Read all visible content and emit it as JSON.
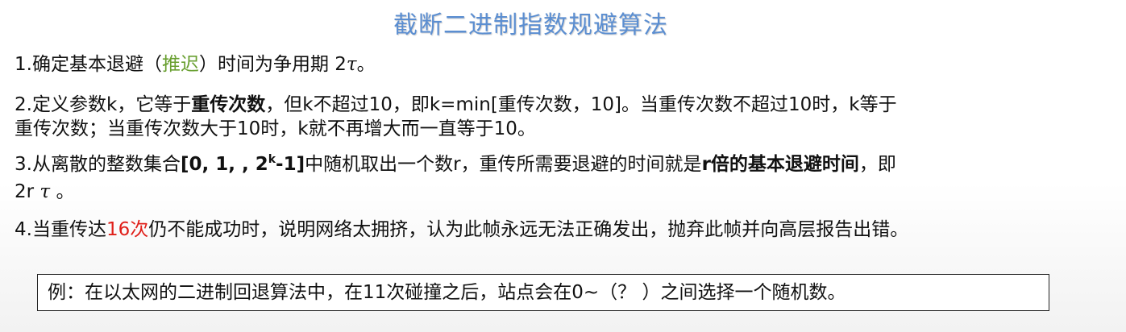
{
  "title": "截断二进制指数规避算法",
  "items": {
    "p1": {
      "pre": "1.确定基本退避（",
      "green": "推迟",
      "mid": "）时间为争用期 2",
      "tau": "τ",
      "post": "。"
    },
    "p2": {
      "line1_pre": "2.定义参数k，它等于",
      "line1_bold": "重传次数",
      "line1_post": "，但k不超过10，即k=min[重传次数，10]。当重传次数不超过10时，k等于",
      "line2": "重传次数；当重传次数大于10时，k就不再增大而一直等于10。"
    },
    "p3": {
      "pre": "3.从离散的整数集合",
      "set_open": "[0, 1, , 2",
      "sup": "k",
      "set_close": "-1]",
      "mid": "中随机取出一个数r，重传所需要退避的时间就是",
      "bold": "r倍的基本退避时间",
      "post": "，即",
      "line2_pre": "2r ",
      "line2_tau": "τ",
      "line2_post": " 。"
    },
    "p4": {
      "pre": "4.当重传达",
      "red": "16次",
      "post": "仍不能成功时，说明网络太拥挤，认为此帧永远无法正确发出，抛弃此帧并向高层报告出错。"
    }
  },
  "example": "例：在以太网的二进制回退算法中，在11次碰撞之后，站点会在0~（？ ）之间选择一个随机数。",
  "colors": {
    "title": "#5b8ed1",
    "highlight_green": "#6aa032",
    "highlight_red": "#e0201a"
  }
}
